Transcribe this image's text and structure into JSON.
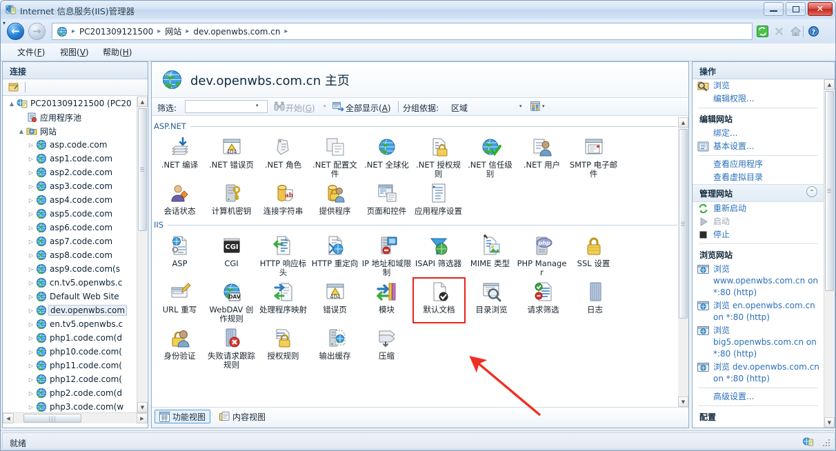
{
  "window": {
    "title": "Internet 信息服务(IIS)管理器",
    "title_icon": "iis-manager-icon",
    "minimize_label": "最小化",
    "maximize_label": "最大化",
    "close_label": "关闭"
  },
  "address_bar": {
    "back_label": "后退",
    "forward_label": "前进",
    "globe_icon": "globe-icon",
    "crumbs": [
      "PC201309121500",
      "网站",
      "dev.openwbs.com.cn"
    ],
    "separator": "▸",
    "refresh_icon": "refresh-icon",
    "stop_icon": "stop-icon",
    "home_icon": "home-icon",
    "help_icon": "help-icon",
    "dropdown_arrow": "▾"
  },
  "menu": {
    "items": [
      {
        "label": "文件",
        "accel": "F"
      },
      {
        "label": "视图",
        "accel": "V"
      },
      {
        "label": "帮助",
        "accel": "H"
      }
    ]
  },
  "connections": {
    "header": "连接",
    "toolbar_icon": "connect-to-server-icon",
    "tree": [
      {
        "label": "PC201309121500 (PC20",
        "indent": 0,
        "expander": "▲",
        "icon": "server-icon",
        "selected": false
      },
      {
        "label": "应用程序池",
        "indent": 1,
        "expander": "",
        "icon": "app-pools-icon",
        "selected": false
      },
      {
        "label": "网站",
        "indent": 1,
        "expander": "▲",
        "icon": "sites-folder-icon",
        "selected": false
      },
      {
        "label": "asp.code.com",
        "indent": 2,
        "expander": "▷",
        "icon": "site-icon",
        "selected": false
      },
      {
        "label": "asp1.code.com",
        "indent": 2,
        "expander": "▷",
        "icon": "site-icon",
        "selected": false
      },
      {
        "label": "asp2.code.com",
        "indent": 2,
        "expander": "▷",
        "icon": "site-icon",
        "selected": false
      },
      {
        "label": "asp3.code.com",
        "indent": 2,
        "expander": "▷",
        "icon": "site-icon",
        "selected": false
      },
      {
        "label": "asp4.code.com",
        "indent": 2,
        "expander": "▷",
        "icon": "site-icon",
        "selected": false
      },
      {
        "label": "asp5.code.com",
        "indent": 2,
        "expander": "▷",
        "icon": "site-icon",
        "selected": false
      },
      {
        "label": "asp6.code.com",
        "indent": 2,
        "expander": "▷",
        "icon": "site-icon",
        "selected": false
      },
      {
        "label": "asp7.code.com",
        "indent": 2,
        "expander": "▷",
        "icon": "site-icon",
        "selected": false
      },
      {
        "label": "asp8.code.com",
        "indent": 2,
        "expander": "▷",
        "icon": "site-icon",
        "selected": false
      },
      {
        "label": "asp9.code.com(s",
        "indent": 2,
        "expander": "▷",
        "icon": "site-icon",
        "selected": false
      },
      {
        "label": "cn.tv5.openwbs.c",
        "indent": 2,
        "expander": "▷",
        "icon": "site-icon",
        "selected": false
      },
      {
        "label": "Default Web Site",
        "indent": 2,
        "expander": "▷",
        "icon": "site-icon",
        "selected": false
      },
      {
        "label": "dev.openwbs.com",
        "indent": 2,
        "expander": "▷",
        "icon": "site-icon",
        "selected": true
      },
      {
        "label": "en.tv5.openwbs.c",
        "indent": 2,
        "expander": "▷",
        "icon": "site-icon",
        "selected": false
      },
      {
        "label": "php1.code.com(d",
        "indent": 2,
        "expander": "▷",
        "icon": "site-icon",
        "selected": false
      },
      {
        "label": "php10.code.com(",
        "indent": 2,
        "expander": "▷",
        "icon": "site-icon",
        "selected": false
      },
      {
        "label": "php11.code.com(",
        "indent": 2,
        "expander": "▷",
        "icon": "site-icon",
        "selected": false
      },
      {
        "label": "php12.code.com(",
        "indent": 2,
        "expander": "▷",
        "icon": "site-icon",
        "selected": false
      },
      {
        "label": "php2.code.com(d",
        "indent": 2,
        "expander": "▷",
        "icon": "site-icon",
        "selected": false
      },
      {
        "label": "php3.code.com(w",
        "indent": 2,
        "expander": "▷",
        "icon": "site-icon",
        "selected": false
      }
    ]
  },
  "main": {
    "page_icon": "site-globe-icon",
    "page_title": "dev.openwbs.com.cn 主页",
    "filter": {
      "label": "筛选:",
      "value": "",
      "placeholder": "",
      "dropdown_arrow": "▾",
      "go_icon": "binoculars-icon",
      "go_label": "开始",
      "go_accel": "G",
      "go_arrow": "▾",
      "show_all_icon": "show-all-icon",
      "show_all_label": "全部显示",
      "show_all_accel": "A",
      "group_by_label": "分组依据:",
      "group_by_value": "区域",
      "group_by_arrow": "▾",
      "view_icon": "view-mode-icon",
      "view_arrow": "▾"
    },
    "groups": [
      {
        "name": "ASP.NET",
        "rows": [
          [
            {
              "label": ".NET 编译",
              "icon": "net-compilation-icon"
            },
            {
              "label": ".NET 错误页",
              "icon": "net-error-pages-icon"
            },
            {
              "label": ".NET 角色",
              "icon": "net-roles-icon"
            },
            {
              "label": ".NET 配置文件",
              "icon": "net-profile-icon"
            },
            {
              "label": ".NET 全球化",
              "icon": "net-globalization-icon"
            },
            {
              "label": ".NET 授权规则",
              "icon": "net-authorization-icon"
            },
            {
              "label": ".NET 信任级别",
              "icon": "net-trust-levels-icon"
            },
            {
              "label": ".NET 用户",
              "icon": "net-users-icon"
            },
            {
              "label": "SMTP 电子邮件",
              "icon": "smtp-email-icon"
            }
          ],
          [
            {
              "label": "会话状态",
              "icon": "session-state-icon"
            },
            {
              "label": "计算机密钥",
              "icon": "machine-key-icon"
            },
            {
              "label": "连接字符串",
              "icon": "connection-strings-icon"
            },
            {
              "label": "提供程序",
              "icon": "providers-icon"
            },
            {
              "label": "页面和控件",
              "icon": "pages-controls-icon"
            },
            {
              "label": "应用程序设置",
              "icon": "application-settings-icon"
            }
          ]
        ]
      },
      {
        "name": "IIS",
        "rows": [
          [
            {
              "label": "ASP",
              "icon": "asp-icon"
            },
            {
              "label": "CGI",
              "icon": "cgi-icon"
            },
            {
              "label": "HTTP 响应标头",
              "icon": "http-response-headers-icon"
            },
            {
              "label": "HTTP 重定向",
              "icon": "http-redirect-icon"
            },
            {
              "label": "IP 地址和域限制",
              "icon": "ip-address-restrictions-icon"
            },
            {
              "label": "ISAPI 筛选器",
              "icon": "isapi-filters-icon"
            },
            {
              "label": "MIME 类型",
              "icon": "mime-types-icon"
            },
            {
              "label": "PHP Manager",
              "icon": "php-manager-icon"
            },
            {
              "label": "SSL 设置",
              "icon": "ssl-settings-icon"
            }
          ],
          [
            {
              "label": "URL 重写",
              "icon": "url-rewrite-icon"
            },
            {
              "label": "WebDAV 创作规则",
              "icon": "webdav-authoring-rules-icon"
            },
            {
              "label": "处理程序映射",
              "icon": "handler-mappings-icon"
            },
            {
              "label": "错误页",
              "icon": "error-pages-icon"
            },
            {
              "label": "模块",
              "icon": "modules-icon"
            },
            {
              "label": "默认文档",
              "icon": "default-document-icon",
              "highlighted": true
            },
            {
              "label": "目录浏览",
              "icon": "directory-browsing-icon"
            },
            {
              "label": "请求筛选",
              "icon": "request-filtering-icon"
            },
            {
              "label": "日志",
              "icon": "logging-icon"
            }
          ],
          [
            {
              "label": "身份验证",
              "icon": "authentication-icon"
            },
            {
              "label": "失败请求跟踪规则",
              "icon": "failed-request-tracing-icon"
            },
            {
              "label": "授权规则",
              "icon": "authorization-rules-icon"
            },
            {
              "label": "输出缓存",
              "icon": "output-caching-icon"
            },
            {
              "label": "压缩",
              "icon": "compression-icon"
            }
          ]
        ]
      }
    ],
    "view_tabs": [
      {
        "label": "功能视图",
        "icon": "features-view-icon",
        "selected": true
      },
      {
        "label": "内容视图",
        "icon": "content-view-icon",
        "selected": false
      }
    ]
  },
  "actions": {
    "header": "操作",
    "items": [
      {
        "label": "浏览",
        "icon": "browse-icon",
        "type": "link"
      },
      {
        "label": "编辑权限...",
        "icon": "",
        "type": "link"
      },
      {
        "type": "separator"
      },
      {
        "label": "编辑网站",
        "type": "section"
      },
      {
        "label": "绑定...",
        "icon": "",
        "type": "link"
      },
      {
        "label": "基本设置...",
        "icon": "basic-settings-icon",
        "type": "link"
      },
      {
        "type": "separator"
      },
      {
        "label": "查看应用程序",
        "icon": "",
        "type": "link"
      },
      {
        "label": "查看虚拟目录",
        "icon": "",
        "type": "link"
      },
      {
        "label": "管理网站",
        "type": "section-bg",
        "collapse": "⌃"
      },
      {
        "label": "重新启动",
        "icon": "restart-icon",
        "type": "link"
      },
      {
        "label": "启动",
        "icon": "start-icon",
        "type": "link-disabled"
      },
      {
        "label": "停止",
        "icon": "stop-square-icon",
        "type": "link"
      },
      {
        "type": "separator"
      },
      {
        "label": "浏览网站",
        "type": "section"
      },
      {
        "label": "浏览 www.openwbs.com.cn on *:80 (http)",
        "icon": "browse-site-icon",
        "type": "link"
      },
      {
        "label": "浏览 en.openwbs.com.cn on *:80 (http)",
        "icon": "browse-site-icon",
        "type": "link"
      },
      {
        "label": "浏览 big5.openwbs.com.cn on *:80 (http)",
        "icon": "browse-site-icon",
        "type": "link"
      },
      {
        "label": "浏览 dev.openwbs.com.cn on *:80 (http)",
        "icon": "browse-site-icon",
        "type": "link"
      },
      {
        "type": "separator"
      },
      {
        "label": "高级设置...",
        "icon": "",
        "type": "link"
      },
      {
        "type": "separator"
      },
      {
        "label": "配置",
        "type": "section"
      }
    ]
  },
  "status": {
    "text": "就绪",
    "icon": "status-iis-icon",
    "grip": "resize-grip"
  },
  "annotation": {
    "highlight_color": "#e8211a",
    "arrow_color": "#ef2f22",
    "target": "默认文档"
  }
}
